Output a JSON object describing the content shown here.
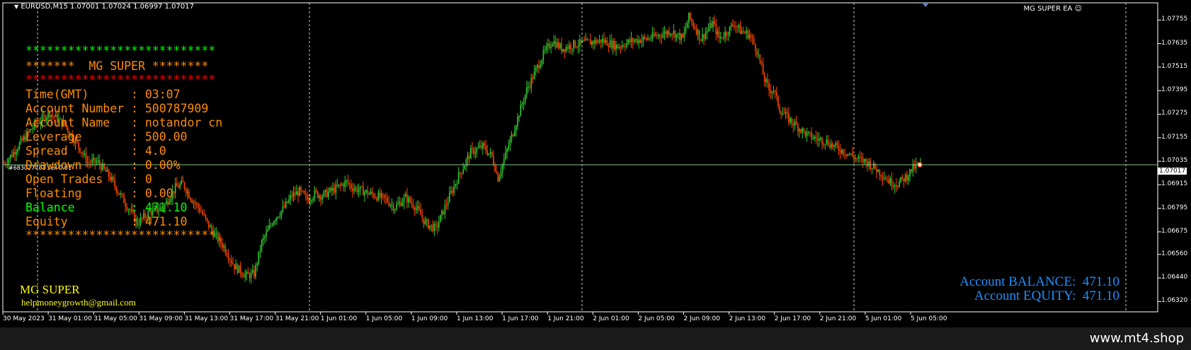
{
  "symbol_bar": {
    "text": "EURUSD,M15  1.07001 1.07024 1.06997 1.07017"
  },
  "ea_name": "MG SUPER EA",
  "current_price": "1.07017",
  "order_tag": "#683027701 sell 0.01",
  "price_scale": [
    "1.07755",
    "1.07635",
    "1.07515",
    "1.07395",
    "1.07275",
    "1.07155",
    "1.07035",
    "1.06915",
    "1.06795",
    "1.06675",
    "1.06560",
    "1.06440",
    "1.06320"
  ],
  "time_scale": [
    "30 May 2023",
    "31 May 01:00",
    "31 May 05:00",
    "31 May 09:00",
    "31 May 13:00",
    "31 May 17:00",
    "31 May 21:00",
    "1 Jun 01:00",
    "1 Jun 05:00",
    "1 Jun 09:00",
    "1 Jun 13:00",
    "1 Jun 17:00",
    "1 Jun 21:00",
    "2 Jun 01:00",
    "2 Jun 05:00",
    "2 Jun 09:00",
    "2 Jun 13:00",
    "2 Jun 17:00",
    "2 Jun 21:00",
    "5 Jun 01:00",
    "5 Jun 05:00"
  ],
  "panel": {
    "stars_green": "***************************",
    "stars_header": "*******  MG SUPER ********",
    "stars_red": "***************************",
    "rows": [
      {
        "label": "Time(GMT)      ",
        "sep": ": ",
        "value": "03:07"
      },
      {
        "label": "Account Number ",
        "sep": ": ",
        "value": "500787909"
      },
      {
        "label": "Account Name   ",
        "sep": ": ",
        "value": "notandor cn"
      },
      {
        "label": "Leverage       ",
        "sep": ": ",
        "value": "500.00"
      },
      {
        "label": "Spread         ",
        "sep": ": ",
        "value": "4.0"
      },
      {
        "label": "Drawdown       ",
        "sep": ": ",
        "value": "0.00%"
      },
      {
        "label": "Open Trades    ",
        "sep": ": ",
        "value": "0"
      },
      {
        "label": "Floating       ",
        "sep": ": ",
        "value": "0.00"
      }
    ],
    "balance": {
      "label": "Balance        ",
      "sep": ": ",
      "value": "471.10"
    },
    "equity": {
      "label": "Equity         ",
      "sep": ": ",
      "value": "471.10"
    },
    "stars_bottom": "***************************"
  },
  "brand": {
    "name": "MG SUPER",
    "email": "helpmoneygrowth@gmail.com"
  },
  "account_summary": {
    "balance": "Account BALANCE:  471.10",
    "equity": "Account EQUITY:  471.10"
  },
  "watermark": "www.mt4.shop",
  "colors": {
    "bull": "#32cd32",
    "bear": "#ff4500",
    "panel_orange": "#ff8c00",
    "panel_green": "#00ff00",
    "panel_red": "#ff0000",
    "account_blue": "#1e90ff",
    "brand_yellow": "#ffff00"
  },
  "chart_data": {
    "type": "candlestick",
    "symbol": "EURUSD",
    "timeframe": "M15",
    "last_close": 1.07017,
    "ylim": [
      1.0626,
      1.0785
    ],
    "path": [
      [
        0,
        1.0702
      ],
      [
        10,
        1.0712
      ],
      [
        20,
        1.0722
      ],
      [
        30,
        1.0728
      ],
      [
        40,
        1.0722
      ],
      [
        50,
        1.071
      ],
      [
        55,
        1.0703
      ],
      [
        62,
        1.0703
      ],
      [
        70,
        1.0695
      ],
      [
        80,
        1.0682
      ],
      [
        88,
        1.0672
      ],
      [
        95,
        1.0677
      ],
      [
        105,
        1.068
      ],
      [
        113,
        1.069
      ],
      [
        118,
        1.0692
      ],
      [
        124,
        1.0684
      ],
      [
        130,
        1.0678
      ],
      [
        134,
        1.0672
      ],
      [
        138,
        1.0667
      ],
      [
        145,
        1.066
      ],
      [
        152,
        1.065
      ],
      [
        160,
        1.0645
      ],
      [
        165,
        1.0646
      ],
      [
        170,
        1.0662
      ],
      [
        178,
        1.0674
      ],
      [
        185,
        1.068
      ],
      [
        190,
        1.0686
      ],
      [
        195,
        1.0688
      ],
      [
        200,
        1.0684
      ],
      [
        205,
        1.0687
      ],
      [
        210,
        1.0686
      ],
      [
        220,
        1.069
      ],
      [
        226,
        1.0693
      ],
      [
        230,
        1.069
      ],
      [
        238,
        1.0688
      ],
      [
        245,
        1.0686
      ],
      [
        252,
        1.0684
      ],
      [
        258,
        1.068
      ],
      [
        265,
        1.0685
      ],
      [
        272,
        1.068
      ],
      [
        278,
        1.0672
      ],
      [
        285,
        1.0669
      ],
      [
        292,
        1.0682
      ],
      [
        300,
        1.0696
      ],
      [
        308,
        1.0708
      ],
      [
        316,
        1.0711
      ],
      [
        322,
        1.0706
      ],
      [
        326,
        1.0695
      ],
      [
        335,
        1.0716
      ],
      [
        345,
        1.074
      ],
      [
        356,
        1.0758
      ],
      [
        362,
        1.0765
      ],
      [
        368,
        1.0761
      ],
      [
        376,
        1.0763
      ],
      [
        385,
        1.0764
      ],
      [
        395,
        1.0765
      ],
      [
        405,
        1.0762
      ],
      [
        415,
        1.0765
      ],
      [
        425,
        1.0766
      ],
      [
        433,
        1.0768
      ],
      [
        440,
        1.077
      ],
      [
        448,
        1.0766
      ],
      [
        452,
        1.0777
      ],
      [
        456,
        1.0772
      ],
      [
        460,
        1.0766
      ],
      [
        465,
        1.0771
      ],
      [
        468,
        1.0774
      ],
      [
        472,
        1.0766
      ],
      [
        478,
        1.077
      ],
      [
        482,
        1.0774
      ],
      [
        486,
        1.077
      ],
      [
        492,
        1.0768
      ],
      [
        497,
        1.076
      ],
      [
        502,
        1.0745
      ],
      [
        505,
        1.074
      ],
      [
        508,
        1.074
      ],
      [
        512,
        1.073
      ],
      [
        518,
        1.0725
      ],
      [
        524,
        1.0721
      ],
      [
        530,
        1.0717
      ],
      [
        536,
        1.0715
      ],
      [
        542,
        1.0714
      ],
      [
        548,
        1.0711
      ],
      [
        556,
        1.0708
      ],
      [
        562,
        1.0705
      ],
      [
        570,
        1.0703
      ],
      [
        578,
        1.0698
      ],
      [
        585,
        1.0693
      ],
      [
        590,
        1.0692
      ],
      [
        596,
        1.0696
      ],
      [
        600,
        1.07
      ],
      [
        605,
        1.0702
      ]
    ]
  }
}
